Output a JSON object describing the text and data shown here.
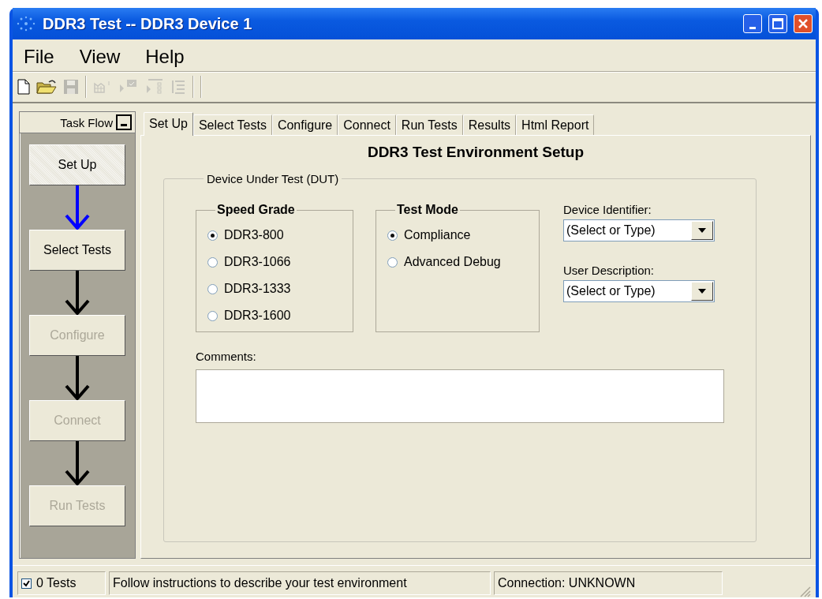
{
  "window": {
    "title": "DDR3 Test -- DDR3 Device 1"
  },
  "menu": [
    "File",
    "View",
    "Help"
  ],
  "toolbar": [
    {
      "kind": "new",
      "disabled": false
    },
    {
      "kind": "open",
      "disabled": false
    },
    {
      "kind": "save",
      "disabled": true
    },
    {
      "kind": "separator"
    },
    {
      "kind": "chart",
      "disabled": true
    },
    {
      "kind": "flag",
      "disabled": true
    },
    {
      "kind": "list",
      "disabled": true
    },
    {
      "kind": "indent",
      "disabled": true
    },
    {
      "kind": "separator"
    },
    {
      "kind": "separator"
    }
  ],
  "task_flow": {
    "title": "Task Flow",
    "steps": [
      {
        "label": "Set Up",
        "selected": true,
        "disabled": false
      },
      {
        "label": "Select Tests",
        "selected": false,
        "disabled": false
      },
      {
        "label": "Configure",
        "selected": false,
        "disabled": true
      },
      {
        "label": "Connect",
        "selected": false,
        "disabled": true
      },
      {
        "label": "Run Tests",
        "selected": false,
        "disabled": true
      }
    ]
  },
  "tabs": [
    {
      "label": "Set Up",
      "selected": true
    },
    {
      "label": "Select Tests",
      "selected": false
    },
    {
      "label": "Configure",
      "selected": false
    },
    {
      "label": "Connect",
      "selected": false
    },
    {
      "label": "Run Tests",
      "selected": false
    },
    {
      "label": "Results",
      "selected": false
    },
    {
      "label": "Html Report",
      "selected": false
    }
  ],
  "setup": {
    "heading": "DDR3 Test Environment Setup",
    "group": "Device Under Test (DUT)",
    "speed_grade": {
      "title": "Speed Grade",
      "options": [
        {
          "label": "DDR3-800",
          "selected": true
        },
        {
          "label": "DDR3-1066",
          "selected": false
        },
        {
          "label": "DDR3-1333",
          "selected": false
        },
        {
          "label": "DDR3-1600",
          "selected": false
        }
      ]
    },
    "test_mode": {
      "title": "Test Mode",
      "options": [
        {
          "label": "Compliance",
          "selected": true
        },
        {
          "label": "Advanced Debug",
          "selected": false
        }
      ]
    },
    "device_identifier": {
      "label": "Device Identifier:",
      "value": "(Select or Type)"
    },
    "user_description": {
      "label": "User Description:",
      "value": "(Select or Type)"
    },
    "comments": {
      "label": "Comments:"
    }
  },
  "status_bar": {
    "tests": {
      "label": "0 Tests",
      "checked": true
    },
    "message": "Follow instructions to describe your test environment",
    "connection": "Connection: UNKNOWN"
  }
}
